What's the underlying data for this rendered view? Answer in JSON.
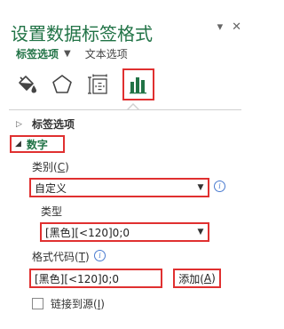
{
  "pane": {
    "title": "设置数据标签格式",
    "controls": {
      "options_chevron": "▾",
      "close": "✕"
    }
  },
  "subtabs": {
    "active": "标签选项",
    "chevron": "▼",
    "other": "文本选项"
  },
  "icons": [
    {
      "name": "fill-line-icon"
    },
    {
      "name": "effects-pentagon-icon"
    },
    {
      "name": "size-properties-icon"
    },
    {
      "name": "bar-chart-options-icon",
      "active": true
    }
  ],
  "sections": {
    "label_options": {
      "label": "标签选项",
      "triangle": "▷"
    },
    "number": {
      "label": "数字",
      "triangle": "◢"
    }
  },
  "category": {
    "label": "类别(C)",
    "label_text": "类别(",
    "label_key": "C",
    "label_end": ")",
    "value": "自定义"
  },
  "type": {
    "label": "类型",
    "value": "[黑色][<120]0;0"
  },
  "format_code": {
    "label": "格式代码(T)",
    "label_text": "格式代码(",
    "label_key": "T",
    "label_end": ")",
    "value": "[黑色][<120]0;0"
  },
  "add_button": {
    "label_text": "添加(",
    "label_key": "A",
    "label_end": ")"
  },
  "linked_source": {
    "label_text": "链接到源(",
    "label_key": "I",
    "label_end": ")",
    "checked": false
  },
  "colors": {
    "accent": "#217346",
    "highlight": "#e03030",
    "info": "#4a7bd0"
  }
}
